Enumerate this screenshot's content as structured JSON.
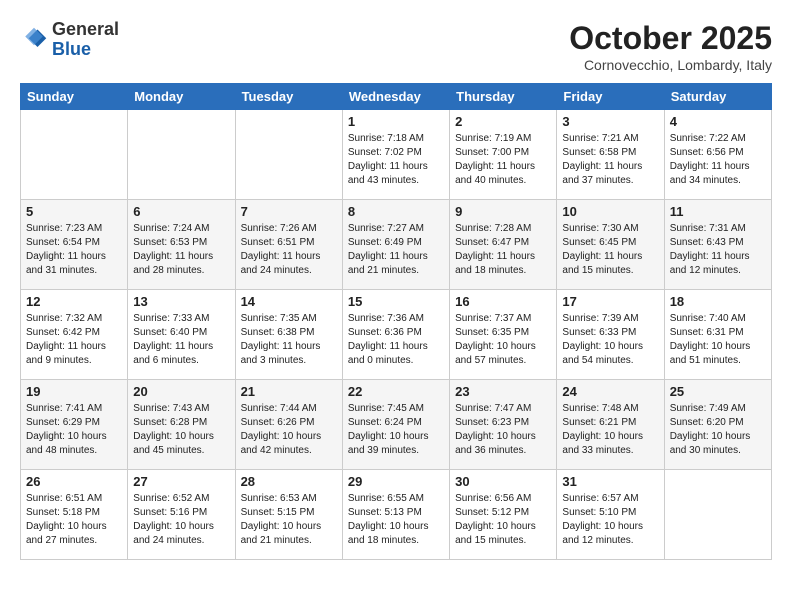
{
  "header": {
    "logo_general": "General",
    "logo_blue": "Blue",
    "month": "October 2025",
    "location": "Cornovecchio, Lombardy, Italy"
  },
  "weekdays": [
    "Sunday",
    "Monday",
    "Tuesday",
    "Wednesday",
    "Thursday",
    "Friday",
    "Saturday"
  ],
  "weeks": [
    [
      {
        "day": "",
        "info": ""
      },
      {
        "day": "",
        "info": ""
      },
      {
        "day": "",
        "info": ""
      },
      {
        "day": "1",
        "info": "Sunrise: 7:18 AM\nSunset: 7:02 PM\nDaylight: 11 hours and 43 minutes."
      },
      {
        "day": "2",
        "info": "Sunrise: 7:19 AM\nSunset: 7:00 PM\nDaylight: 11 hours and 40 minutes."
      },
      {
        "day": "3",
        "info": "Sunrise: 7:21 AM\nSunset: 6:58 PM\nDaylight: 11 hours and 37 minutes."
      },
      {
        "day": "4",
        "info": "Sunrise: 7:22 AM\nSunset: 6:56 PM\nDaylight: 11 hours and 34 minutes."
      }
    ],
    [
      {
        "day": "5",
        "info": "Sunrise: 7:23 AM\nSunset: 6:54 PM\nDaylight: 11 hours and 31 minutes."
      },
      {
        "day": "6",
        "info": "Sunrise: 7:24 AM\nSunset: 6:53 PM\nDaylight: 11 hours and 28 minutes."
      },
      {
        "day": "7",
        "info": "Sunrise: 7:26 AM\nSunset: 6:51 PM\nDaylight: 11 hours and 24 minutes."
      },
      {
        "day": "8",
        "info": "Sunrise: 7:27 AM\nSunset: 6:49 PM\nDaylight: 11 hours and 21 minutes."
      },
      {
        "day": "9",
        "info": "Sunrise: 7:28 AM\nSunset: 6:47 PM\nDaylight: 11 hours and 18 minutes."
      },
      {
        "day": "10",
        "info": "Sunrise: 7:30 AM\nSunset: 6:45 PM\nDaylight: 11 hours and 15 minutes."
      },
      {
        "day": "11",
        "info": "Sunrise: 7:31 AM\nSunset: 6:43 PM\nDaylight: 11 hours and 12 minutes."
      }
    ],
    [
      {
        "day": "12",
        "info": "Sunrise: 7:32 AM\nSunset: 6:42 PM\nDaylight: 11 hours and 9 minutes."
      },
      {
        "day": "13",
        "info": "Sunrise: 7:33 AM\nSunset: 6:40 PM\nDaylight: 11 hours and 6 minutes."
      },
      {
        "day": "14",
        "info": "Sunrise: 7:35 AM\nSunset: 6:38 PM\nDaylight: 11 hours and 3 minutes."
      },
      {
        "day": "15",
        "info": "Sunrise: 7:36 AM\nSunset: 6:36 PM\nDaylight: 11 hours and 0 minutes."
      },
      {
        "day": "16",
        "info": "Sunrise: 7:37 AM\nSunset: 6:35 PM\nDaylight: 10 hours and 57 minutes."
      },
      {
        "day": "17",
        "info": "Sunrise: 7:39 AM\nSunset: 6:33 PM\nDaylight: 10 hours and 54 minutes."
      },
      {
        "day": "18",
        "info": "Sunrise: 7:40 AM\nSunset: 6:31 PM\nDaylight: 10 hours and 51 minutes."
      }
    ],
    [
      {
        "day": "19",
        "info": "Sunrise: 7:41 AM\nSunset: 6:29 PM\nDaylight: 10 hours and 48 minutes."
      },
      {
        "day": "20",
        "info": "Sunrise: 7:43 AM\nSunset: 6:28 PM\nDaylight: 10 hours and 45 minutes."
      },
      {
        "day": "21",
        "info": "Sunrise: 7:44 AM\nSunset: 6:26 PM\nDaylight: 10 hours and 42 minutes."
      },
      {
        "day": "22",
        "info": "Sunrise: 7:45 AM\nSunset: 6:24 PM\nDaylight: 10 hours and 39 minutes."
      },
      {
        "day": "23",
        "info": "Sunrise: 7:47 AM\nSunset: 6:23 PM\nDaylight: 10 hours and 36 minutes."
      },
      {
        "day": "24",
        "info": "Sunrise: 7:48 AM\nSunset: 6:21 PM\nDaylight: 10 hours and 33 minutes."
      },
      {
        "day": "25",
        "info": "Sunrise: 7:49 AM\nSunset: 6:20 PM\nDaylight: 10 hours and 30 minutes."
      }
    ],
    [
      {
        "day": "26",
        "info": "Sunrise: 6:51 AM\nSunset: 5:18 PM\nDaylight: 10 hours and 27 minutes."
      },
      {
        "day": "27",
        "info": "Sunrise: 6:52 AM\nSunset: 5:16 PM\nDaylight: 10 hours and 24 minutes."
      },
      {
        "day": "28",
        "info": "Sunrise: 6:53 AM\nSunset: 5:15 PM\nDaylight: 10 hours and 21 minutes."
      },
      {
        "day": "29",
        "info": "Sunrise: 6:55 AM\nSunset: 5:13 PM\nDaylight: 10 hours and 18 minutes."
      },
      {
        "day": "30",
        "info": "Sunrise: 6:56 AM\nSunset: 5:12 PM\nDaylight: 10 hours and 15 minutes."
      },
      {
        "day": "31",
        "info": "Sunrise: 6:57 AM\nSunset: 5:10 PM\nDaylight: 10 hours and 12 minutes."
      },
      {
        "day": "",
        "info": ""
      }
    ]
  ]
}
